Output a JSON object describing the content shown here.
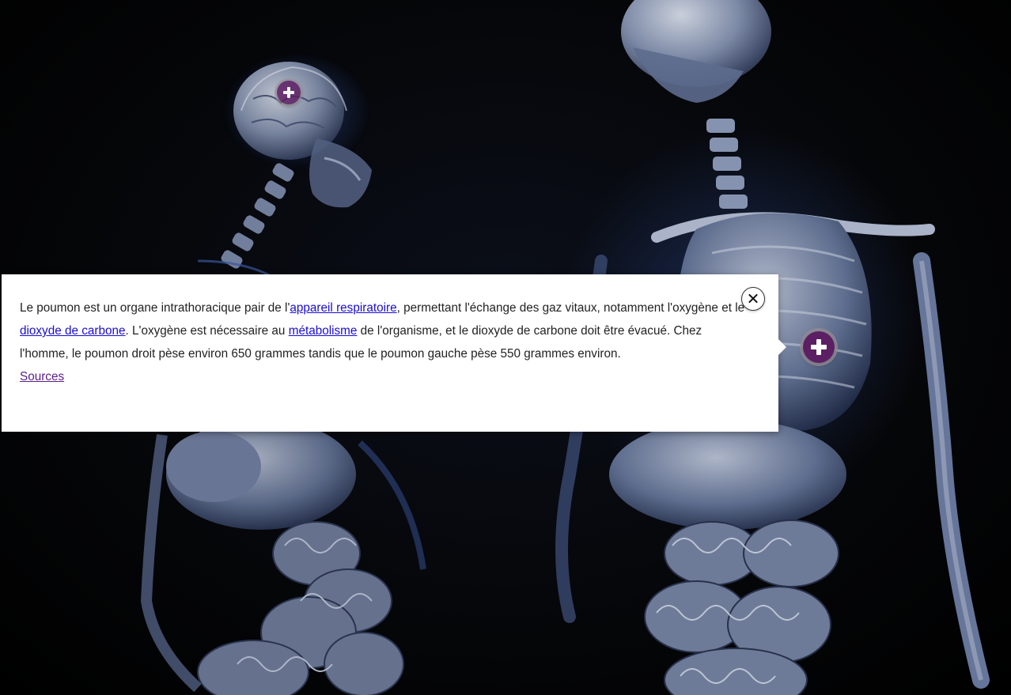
{
  "scene": {
    "image_alt": "Deux squelettes humains avec organes, vue anatomique sur fond noir",
    "hotspots": [
      {
        "name": "brain",
        "icon": "plus-icon",
        "color": "#5c1f63"
      },
      {
        "name": "lung",
        "icon": "plus-icon",
        "color": "#5c1f63"
      }
    ]
  },
  "popup": {
    "text_1": "Le poumon est un organe intrathoracique pair de l'",
    "link_1": "appareil respiratoire",
    "text_2": ", permettant l'échange des gaz vitaux, notamment l'oxygène et le ",
    "link_2": "dioxyde de carbone",
    "text_3": ". L'oxygène est nécessaire au ",
    "link_3": "métabolisme",
    "text_4": " de l'organisme, et le dioxyde de carbone doit être évacué. Chez l'homme, le poumon droit pèse environ 650 grammes tandis que le poumon gauche pèse 550 grammes environ.",
    "sources_label": "Sources",
    "close_icon": "close-icon",
    "link_color": "#1a0dcc",
    "visited_link_color": "#5b1f88"
  }
}
